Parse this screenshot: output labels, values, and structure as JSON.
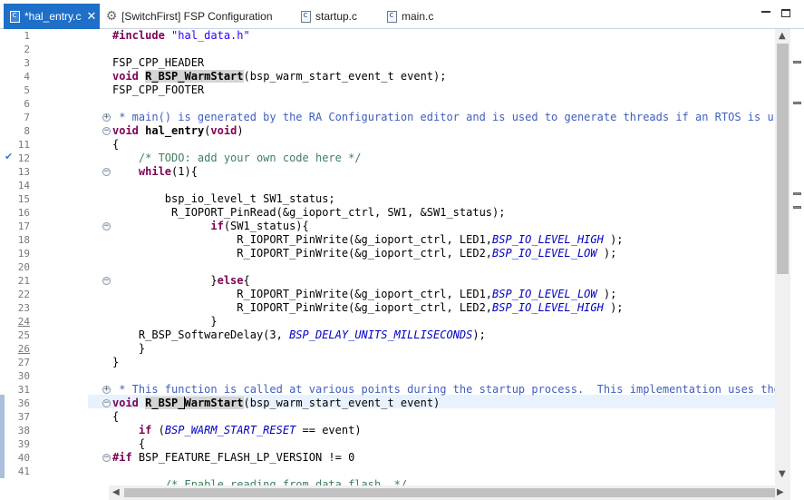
{
  "tabs": [
    {
      "label": "*hal_entry.c",
      "icon": "c-file-icon",
      "active": true
    },
    {
      "label": "[SwitchFirst] FSP Configuration",
      "icon": "gear-icon",
      "active": false
    },
    {
      "label": "startup.c",
      "icon": "c-file-icon",
      "active": false
    },
    {
      "label": "main.c",
      "icon": "c-file-icon",
      "active": false
    }
  ],
  "window_controls": {
    "minimize": "minimize",
    "maximize": "maximize"
  },
  "colors": {
    "accent": "#1e6fc8",
    "keyword": "#7f0055",
    "string": "#2a00ff",
    "comment": "#3f7f5f",
    "enum_constant": "#0000c0",
    "current_line": "#e8f2fe"
  },
  "line_numbers": [
    "1",
    "2",
    "3",
    "4",
    "5",
    "6",
    "7",
    "8",
    "11",
    "12",
    "13",
    "14",
    "15",
    "16",
    "17",
    "18",
    "19",
    "20",
    "21",
    "22",
    "23",
    "24",
    "25",
    "26",
    "27",
    "30",
    "31",
    "36",
    "37",
    "38",
    "39",
    "40",
    "41"
  ],
  "code": {
    "l1a": "#include",
    "l1b": " ",
    "l1c": "\"hal_data.h\"",
    "l3": "FSP_CPP_HEADER",
    "l4a": "void",
    "l4b": " ",
    "l4c": "R_BSP_WarmStart",
    "l4d": "(bsp_warm_start_event_t event);",
    "l5": "FSP_CPP_FOOTER",
    "l8": " * main() is generated by the RA Configuration editor and is used to generate threads if an RTOS is used.",
    "l11a": "void",
    "l11b": " ",
    "l11c": "hal_entry",
    "l11d": "(",
    "l11e": "void",
    "l11f": ")",
    "l12": "{",
    "l13": "    /* TODO: add your own code here */",
    "l14a": "    ",
    "l14b": "while",
    "l14c": "(1){",
    "l16": "        bsp_io_level_t SW1_status;",
    "l17": "         R_IOPORT_PinRead(&g_ioport_ctrl, SW1, &SW1_status);",
    "l18a": "               ",
    "l18b": "if",
    "l18c": "(SW1_status){",
    "l19a": "                   R_IOPORT_PinWrite(&g_ioport_ctrl, LED1,",
    "l19b": "BSP_IO_LEVEL_HIGH",
    "l19c": " );",
    "l20a": "                   R_IOPORT_PinWrite(&g_ioport_ctrl, LED2,",
    "l20b": "BSP_IO_LEVEL_LOW",
    "l20c": " );",
    "l22a": "               }",
    "l22b": "else",
    "l22c": "{",
    "l23a": "                   R_IOPORT_PinWrite(&g_ioport_ctrl, LED1,",
    "l23b": "BSP_IO_LEVEL_LOW",
    "l23c": " );",
    "l24a": "                   R_IOPORT_PinWrite(&g_ioport_ctrl, LED2,",
    "l24b": "BSP_IO_LEVEL_HIGH",
    "l24c": " );",
    "l25": "               }",
    "l26a": "    R_BSP_SoftwareDelay(3, ",
    "l26b": "BSP_DELAY_UNITS_MILLISECONDS",
    "l26c": ");",
    "l27": "    }",
    "l30": "}",
    "l31": " * This function is called at various points during the startup process.  This implementation uses the ev",
    "l36a": "void",
    "l36b": " ",
    "l36c1": "R_BSP_",
    "l36c2": "WarmStart",
    "l36d": "(bsp_warm_start_event_t event)",
    "l37": "{",
    "l38a": "    ",
    "l38b": "if",
    "l38c": " (",
    "l38d": "BSP_WARM_START_RESET",
    "l38e": " == event)",
    "l39": "    {",
    "l40a": "#if",
    "l40b": " BSP_FEATURE_FLASH_LP_VERSION != 0",
    "l42": "        /* Enable reading from data flash. */"
  }
}
